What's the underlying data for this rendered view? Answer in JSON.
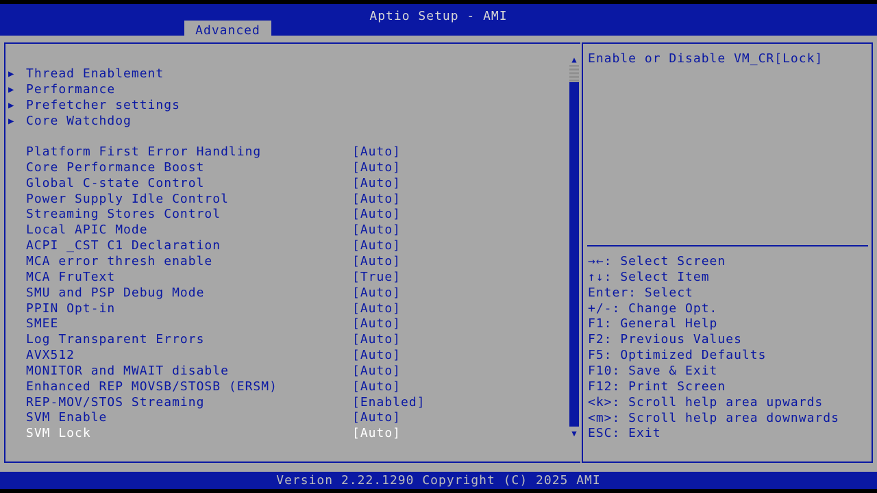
{
  "header": {
    "title": "Aptio Setup - AMI",
    "tab": "Advanced"
  },
  "submenus": [
    {
      "label": "Thread Enablement"
    },
    {
      "label": "Performance"
    },
    {
      "label": "Prefetcher settings"
    },
    {
      "label": "Core Watchdog"
    }
  ],
  "arrow_glyph": "▶",
  "settings": [
    {
      "label": "Platform First Error Handling",
      "value": "[Auto]"
    },
    {
      "label": "Core Performance Boost",
      "value": "[Auto]"
    },
    {
      "label": "Global C-state Control",
      "value": "[Auto]"
    },
    {
      "label": "Power Supply Idle Control",
      "value": "[Auto]"
    },
    {
      "label": "Streaming Stores Control",
      "value": "[Auto]"
    },
    {
      "label": "Local APIC Mode",
      "value": "[Auto]"
    },
    {
      "label": "ACPI _CST C1 Declaration",
      "value": "[Auto]"
    },
    {
      "label": "MCA error thresh enable",
      "value": "[Auto]"
    },
    {
      "label": "MCA FruText",
      "value": "[True]"
    },
    {
      "label": "SMU and PSP Debug Mode",
      "value": "[Auto]"
    },
    {
      "label": "PPIN Opt-in",
      "value": "[Auto]"
    },
    {
      "label": "SMEE",
      "value": "[Auto]"
    },
    {
      "label": "Log Transparent Errors",
      "value": "[Auto]"
    },
    {
      "label": "AVX512",
      "value": "[Auto]"
    },
    {
      "label": "MONITOR and MWAIT disable",
      "value": "[Auto]"
    },
    {
      "label": "Enhanced REP MOVSB/STOSB (ERSM)",
      "value": "[Auto]"
    },
    {
      "label": "REP-MOV/STOS Streaming",
      "value": "[Enabled]"
    },
    {
      "label": "SVM Enable",
      "value": "[Auto]"
    },
    {
      "label": "SVM Lock",
      "value": "[Auto]",
      "selected": true
    }
  ],
  "scrollbar": {
    "up_glyph": "▲",
    "down_glyph": "▼",
    "position": 0.0
  },
  "help": {
    "text": "Enable or Disable VM_CR[Lock]"
  },
  "keys": [
    "→←: Select Screen",
    "↑↓: Select Item",
    "Enter: Select",
    "+/-: Change Opt.",
    "F1: General Help",
    "F2: Previous Values",
    "F5: Optimized Defaults",
    "F10: Save & Exit",
    "F12: Print Screen",
    "<k>: Scroll help area upwards",
    "<m>: Scroll help area downwards",
    "ESC: Exit"
  ],
  "footer": {
    "version": "Version 2.22.1290 Copyright (C) 2025 AMI"
  },
  "colors": {
    "blue": "#0a18a3",
    "gray": "#a7a7a7",
    "selected_text": "#ffffff"
  }
}
